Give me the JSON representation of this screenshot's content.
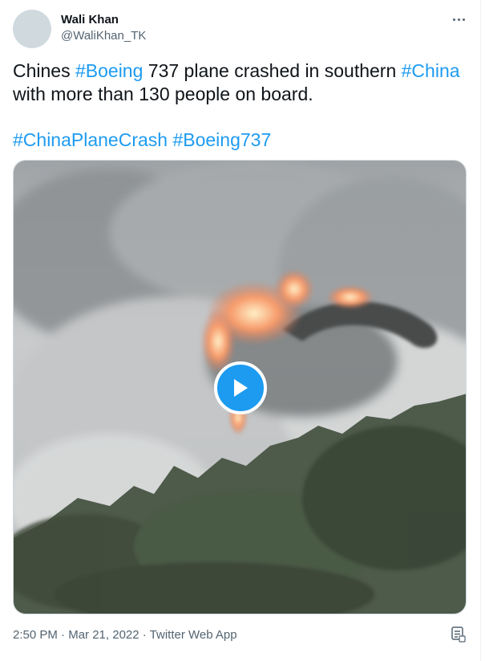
{
  "author": {
    "name": "Wali Khan",
    "handle": "@WaliKhan_TK"
  },
  "tweet": {
    "line1": [
      {
        "text": "Chines ",
        "tag": false
      },
      {
        "text": "#Boeing",
        "tag": true
      },
      {
        "text": " 737 plane crashed in southern ",
        "tag": false
      },
      {
        "text": "#China",
        "tag": true
      }
    ],
    "line2": "with more than 130 people on board.",
    "hashtags": [
      "#ChinaPlaneCrash",
      "#Boeing737"
    ]
  },
  "media": {
    "type": "video",
    "icon": "play-icon"
  },
  "meta": {
    "time": "2:50 PM",
    "separator1": " · ",
    "date": "Mar 21, 2022",
    "separator2": " · ",
    "app": "Twitter Web App"
  },
  "colors": {
    "link": "#1d9bf0",
    "secondary_text": "#536471",
    "play_button": "#1d9bf0"
  },
  "icons": {
    "more": "more-options-icon",
    "translate": "translate-icon"
  }
}
